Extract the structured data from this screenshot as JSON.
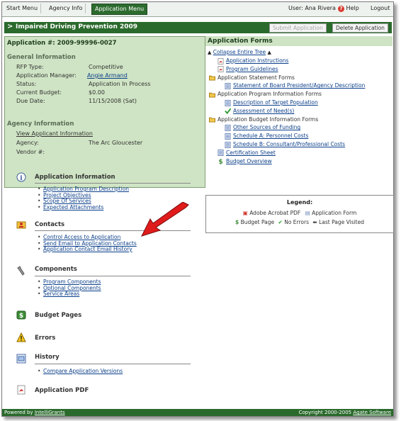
{
  "nav": {
    "start_menu": "Start Menu",
    "agency_info": "Agency Info",
    "application_menu": "Application Menu",
    "user": "User: Ana Rivera",
    "help": "Help",
    "logout": "Logout"
  },
  "titlebar": {
    "title": "Impaired Driving Prevention 2009",
    "submit": "Submit Application",
    "delete": "Delete Application"
  },
  "info": {
    "app_number": "Application #: 2009-99996-0027",
    "general_header": "General Information",
    "fields": [
      {
        "label": "RFP Type:",
        "value": "Competitive"
      },
      {
        "label": "Application Manager:",
        "value": "Angie Armand"
      },
      {
        "label": "Status:",
        "value": "Application In Process"
      },
      {
        "label": "Current Budget:",
        "value": "$0.00"
      },
      {
        "label": "Due Date:",
        "value": "11/15/2008 (Sat)"
      }
    ],
    "agency_header": "Agency Information",
    "view_applicant": "View Applicant Information",
    "agency_label": "Agency:",
    "agency_value": "The Arc Gloucester",
    "vendor_label": "Vendor #:",
    "vendor_value": ""
  },
  "left_sections": {
    "app_info": {
      "title": "Application Information",
      "items": [
        "Application Program Description",
        "Project Objectives",
        "Scope Of Services",
        "Expected Attachments"
      ]
    },
    "contacts": {
      "title": "Contacts",
      "items": [
        "Control Access to Application",
        "Send Email to Application Contacts",
        "Application Contact Email History"
      ]
    },
    "components": {
      "title": "Components",
      "items": [
        "Program Components",
        "Optional Components",
        "Service Areas"
      ]
    },
    "budget": {
      "title": "Budget Pages"
    },
    "errors": {
      "title": "Errors"
    },
    "history": {
      "title": "History",
      "items": [
        "Compare Application Versions"
      ]
    },
    "pdf": {
      "title": "Application PDF"
    }
  },
  "forms": {
    "header": "Application Forms",
    "collapse": "Collapse Entire Tree",
    "items": [
      {
        "label": "Application Instructions",
        "level": 1,
        "icon": "pdf"
      },
      {
        "label": "Program Guidelines",
        "level": 1,
        "icon": "pdf"
      },
      {
        "label": "Application Statement Forms",
        "level": 0,
        "icon": "folder"
      },
      {
        "label": "Statement of Board President/Agency Description",
        "level": 2,
        "icon": "doc"
      },
      {
        "label": "Application Program Information Forms",
        "level": 0,
        "icon": "folder"
      },
      {
        "label": "Description of Target Population",
        "level": 2,
        "icon": "doc"
      },
      {
        "label": "Assessment of Need(s)",
        "level": 2,
        "icon": "check"
      },
      {
        "label": "Application Budget Information Forms",
        "level": 0,
        "icon": "folder"
      },
      {
        "label": "Other Sources of Funding",
        "level": 2,
        "icon": "doc"
      },
      {
        "label": "Schedule A: Personnel Costs",
        "level": 2,
        "icon": "doc"
      },
      {
        "label": "Schedule B: Consultant/Professional Costs",
        "level": 2,
        "icon": "doc"
      },
      {
        "label": "Certification Sheet",
        "level": 1,
        "icon": "doc"
      },
      {
        "label": "Budget Overview",
        "level": 1,
        "icon": "dollar"
      }
    ]
  },
  "legend": {
    "title": "Legend:",
    "pdf": "Adobe Acrobat PDF",
    "form": "Application Form",
    "budget": "Budget Page",
    "no_errors": "No Errors",
    "last_page": "Last Page Visited"
  },
  "footer": {
    "powered": "Powered by",
    "powered_link": "IntelliGrants",
    "copyright": "Copyright 2000-2005",
    "copyright_link": "Agate Software"
  },
  "colors": {
    "accent_green": "#2a6a2c",
    "panel_green": "#cfe4c4",
    "link_blue": "#0b3f8a",
    "arrow_red": "#e01b1b"
  }
}
